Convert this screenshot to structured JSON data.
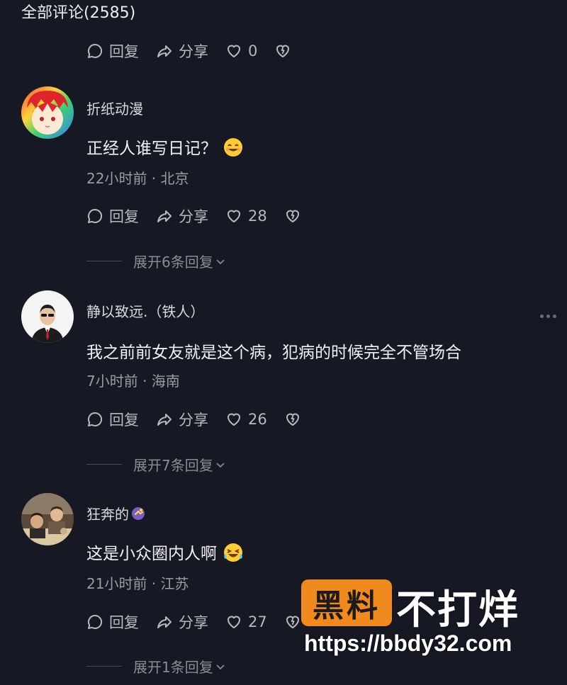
{
  "header": {
    "title": "全部评论(2585)"
  },
  "top_actions": {
    "reply": "回复",
    "share": "分享",
    "likes": "0"
  },
  "comments": [
    {
      "username": "折纸动漫",
      "text": "正经人谁写日记？",
      "meta": "22小时前 · 北京",
      "reply": "回复",
      "share": "分享",
      "likes": "28",
      "expand": "展开6条回复"
    },
    {
      "username": "静以致远.（铁人）",
      "text": "我之前前女友就是这个病，犯病的时候完全不管场合",
      "meta": "7小时前 · 海南",
      "reply": "回复",
      "share": "分享",
      "likes": "26",
      "expand": "展开7条回复"
    },
    {
      "username": "狂奔的",
      "text": "这是小众圈内人啊",
      "meta": "21小时前 · 江苏",
      "reply": "回复",
      "share": "分享",
      "likes": "27",
      "expand": "展开1条回复"
    }
  ],
  "watermark": {
    "box_text": "黑料",
    "big_text": "不打烊",
    "url": "https://bbdy32.com"
  },
  "colors": {
    "background": "#161823",
    "accent": "#f08a1e",
    "secondary_text": "#9b9ca3"
  },
  "icons": [
    "comment-bubble-icon",
    "share-arrow-icon",
    "heart-icon",
    "broken-heart-icon",
    "chevron-down-icon",
    "more-dots-icon"
  ]
}
